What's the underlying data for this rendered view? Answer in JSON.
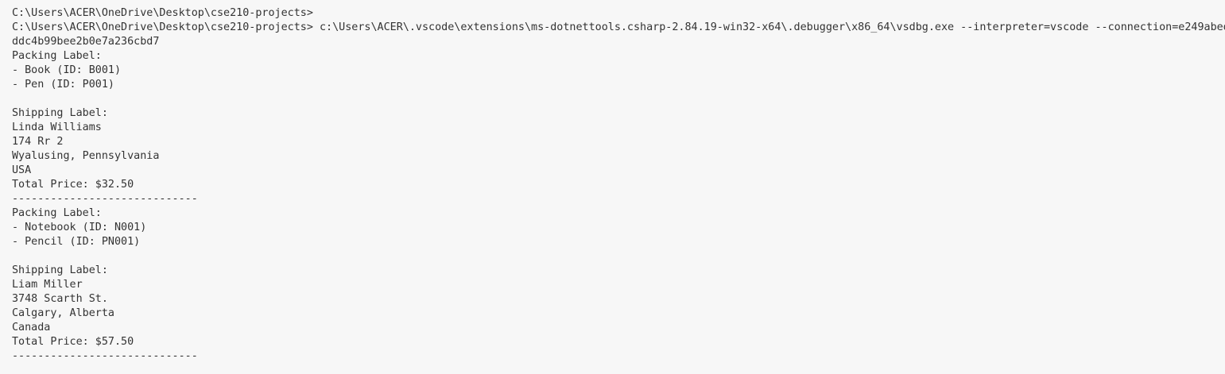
{
  "terminal": {
    "lines": [
      "C:\\Users\\ACER\\OneDrive\\Desktop\\cse210-projects>",
      "C:\\Users\\ACER\\OneDrive\\Desktop\\cse210-projects> c:\\Users\\ACER\\.vscode\\extensions\\ms-dotnettools.csharp-2.84.19-win32-x64\\.debugger\\x86_64\\vsdbg.exe --interpreter=vscode --connection=e249abede",
      "ddc4b99bee2b0e7a236cbd7",
      "Packing Label:",
      "- Book (ID: B001)",
      "- Pen (ID: P001)",
      "",
      "Shipping Label:",
      "Linda Williams",
      "174 Rr 2",
      "Wyalusing, Pennsylvania",
      "USA",
      "Total Price: $32.50",
      "-----------------------------",
      "Packing Label:",
      "- Notebook (ID: N001)",
      "- Pencil (ID: PN001)",
      "",
      "Shipping Label:",
      "Liam Miller",
      "3748 Scarth St.",
      "Calgary, Alberta",
      "Canada",
      "Total Price: $57.50",
      "-----------------------------"
    ]
  }
}
